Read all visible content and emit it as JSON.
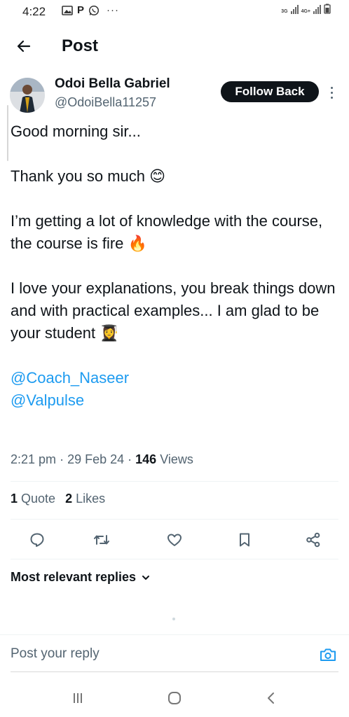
{
  "status_bar": {
    "time": "4:22",
    "p_label": "P",
    "dots": "···",
    "net_3g": "3G",
    "net_4g": "4G+"
  },
  "header": {
    "title": "Post"
  },
  "author": {
    "name": "Odoi Bella Gabriel",
    "handle": "@OdoiBella11257",
    "follow_label": "Follow Back"
  },
  "post": {
    "line1": "Good morning sir...",
    "line2": "Thank you so much 😊",
    "line3": "I’m getting a lot of knowledge with the course, the course is fire 🔥",
    "line4": "I love your explanations, you break things down and with practical examples... I am glad to be your student 👩‍🎓",
    "mention1": "@Coach_Naseer",
    "mention2": "@Valpulse",
    "time": "2:21 pm",
    "date": "29 Feb 24",
    "views_count": "146",
    "views_label": "Views"
  },
  "stats": {
    "quotes_count": "1",
    "quotes_label": "Quote",
    "likes_count": "2",
    "likes_label": "Likes"
  },
  "actions": [
    "reply-icon",
    "retweet-icon",
    "like-icon",
    "bookmark-icon",
    "share-icon"
  ],
  "replies": {
    "sort_label": "Most relevant replies"
  },
  "reply_bar": {
    "placeholder": "Post your reply"
  },
  "colors": {
    "link": "#1d9bf0",
    "text": "#0f1419",
    "muted": "#536471",
    "button": "#0f1419"
  }
}
